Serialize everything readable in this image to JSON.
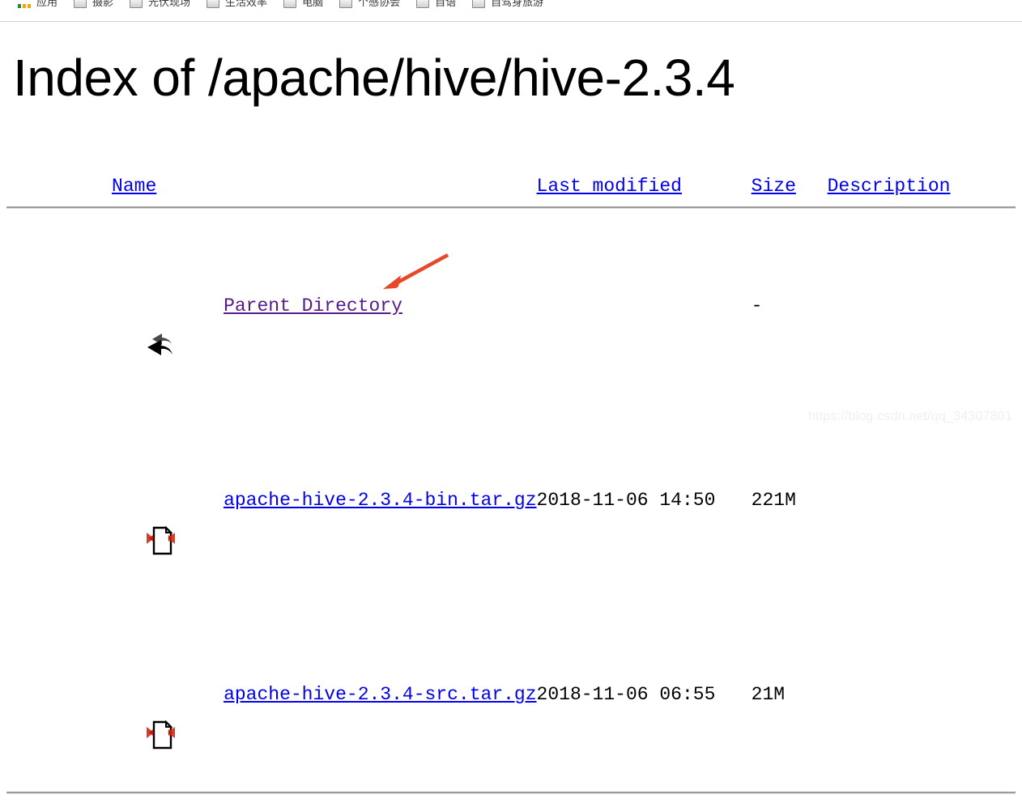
{
  "browser": {
    "bookmarks_bar": {
      "items": [
        {
          "label": "应用",
          "icon": "apps-grid-icon"
        },
        {
          "label": "摄影",
          "icon": "bookmark-page-icon"
        },
        {
          "label": "光伏现场",
          "icon": "bookmark-page-icon"
        },
        {
          "label": "生活效率",
          "icon": "bookmark-page-icon"
        },
        {
          "label": "电脑",
          "icon": "bookmark-page-icon"
        },
        {
          "label": "个感协会",
          "icon": "bookmark-page-icon"
        },
        {
          "label": "自语",
          "icon": "bookmark-page-icon"
        },
        {
          "label": "自驾身旅游",
          "icon": "bookmark-page-icon"
        }
      ]
    }
  },
  "page": {
    "title": "Index of /apache/hive/hive-2.3.4",
    "watermark": "https://blog.csdn.net/qq_34307801"
  },
  "listing": {
    "columns": [
      {
        "key": "name",
        "label": "Name"
      },
      {
        "key": "last_modified",
        "label": "Last modified"
      },
      {
        "key": "size",
        "label": "Size"
      },
      {
        "key": "description",
        "label": "Description"
      }
    ],
    "rows": [
      {
        "icon": "parent-directory-icon",
        "name": "Parent Directory",
        "visited": true,
        "last_modified": "",
        "size": "-",
        "description": ""
      },
      {
        "icon": "compressed-file-icon",
        "name": "apache-hive-2.3.4-bin.tar.gz",
        "visited": false,
        "last_modified": "2018-11-06 14:50",
        "size": "221M",
        "description": ""
      },
      {
        "icon": "compressed-file-icon",
        "name": "apache-hive-2.3.4-src.tar.gz",
        "visited": false,
        "last_modified": "2018-11-06 06:55",
        "size": "21M",
        "description": ""
      }
    ]
  },
  "annotation": {
    "arrow_color": "#e8472a",
    "points_at": "apache-hive-2.3.4-bin.tar.gz"
  },
  "colors": {
    "link": "#0000ee",
    "visited_link": "#551a8b",
    "text": "#000000",
    "rule": "#9a9a9a",
    "arrow": "#e8472a"
  }
}
